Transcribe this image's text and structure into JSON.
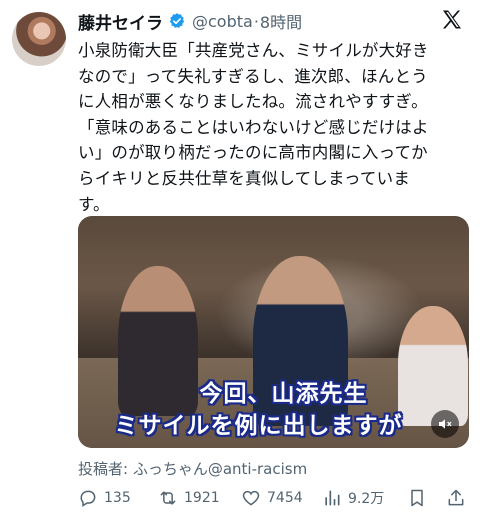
{
  "author": {
    "name": "藤井セイラ",
    "handle": "@cobta",
    "separator": "·",
    "time": "8時間"
  },
  "tweet": {
    "text": "小泉防衛大臣「共産党さん、ミサイルが大好き\nなので」って失礼すぎるし、進次郎、ほんとう\nに人相が悪くなりましたね。流されやすすぎ。\n「意味のあることはいわないけど感じだけはよ\nい」のが取り柄だったのに高市内閣に入ってか\nらイキリと反共仕草を真似してしまっていま\nす。"
  },
  "media": {
    "subtitle_line1": "今回、山添先生",
    "subtitle_line2": "ミサイルを例に出しますが"
  },
  "poster": "投稿者: ふっちゃん@anti-racism",
  "actions": {
    "replies": "135",
    "reposts": "1921",
    "likes": "7454",
    "views": "9.2万"
  },
  "colors": {
    "verified": "#1d9bf0",
    "muted_text": "#536471",
    "subtitle_outline": "#1a2a8a"
  },
  "icons": [
    "verified-icon",
    "x-logo-icon",
    "mute-icon",
    "reply-icon",
    "repost-icon",
    "like-icon",
    "views-icon",
    "bookmark-icon",
    "share-icon"
  ]
}
